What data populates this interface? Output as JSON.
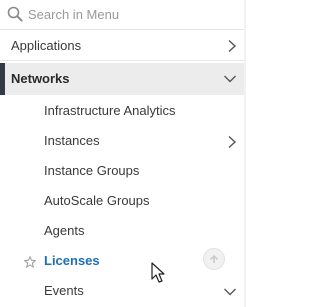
{
  "search": {
    "placeholder": "Search in Menu",
    "value": "",
    "icon": "search-icon"
  },
  "menu": {
    "applications": {
      "label": "Applications",
      "icon": "chevron-right-icon"
    },
    "networks": {
      "label": "Networks",
      "icon": "chevron-down-icon",
      "active": true
    },
    "sub_items": [
      {
        "label": "Infrastructure Analytics"
      },
      {
        "label": "Instances",
        "icon": "chevron-right-icon"
      },
      {
        "label": "Instance Groups"
      },
      {
        "label": "AutoScale Groups"
      },
      {
        "label": "Agents"
      },
      {
        "label": "Licenses",
        "selected": true,
        "icon": "star-icon"
      },
      {
        "label": "Events",
        "icon": "chevron-down-icon"
      }
    ]
  },
  "controls": {
    "scroll_top_icon": "arrow-up-circle-icon",
    "pointer_icon": "mouse-pointer-icon"
  },
  "colors": {
    "active_bar": "#333a45",
    "active_background": "#ececec",
    "selected_text": "#1f6fb5",
    "text": "#3a3a3a",
    "placeholder": "#9a9a9a"
  }
}
